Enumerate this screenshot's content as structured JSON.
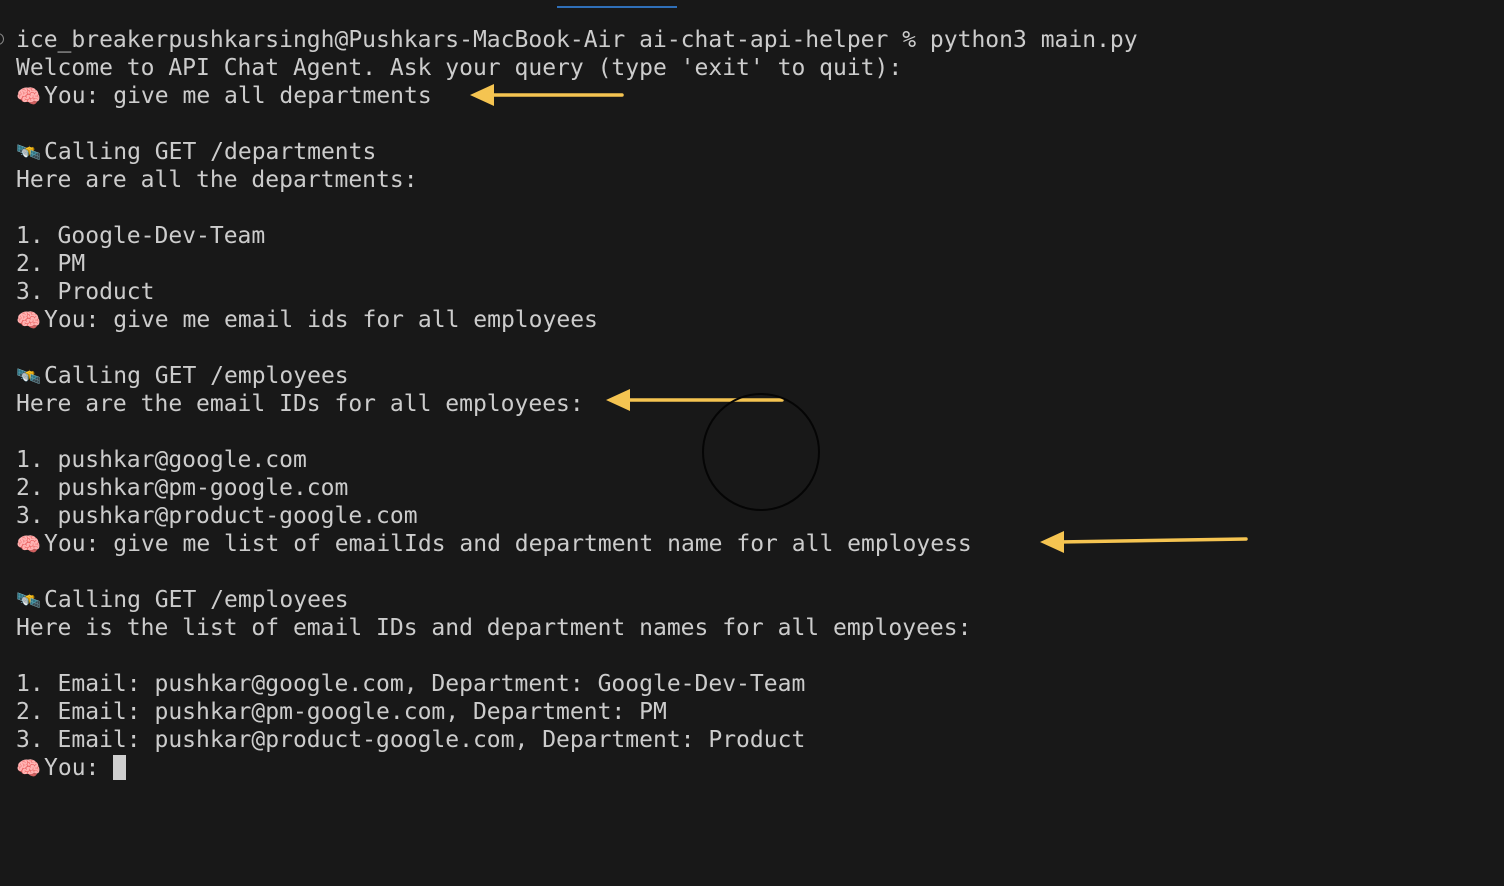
{
  "terminal": {
    "prompt_line": "ice_breakerpushkarsingh@Pushkars-MacBook-Air ai-chat-api-helper % python3 main.py",
    "welcome": "Welcome to API Chat Agent. Ask your query (type 'exit' to quit):",
    "user_emoji": "🧠",
    "tool_emoji": "🛰️",
    "q1": "You: give me all departments",
    "call1": "Calling GET /departments",
    "resp1_header": "Here are all the departments:",
    "resp1_items": [
      "1. Google-Dev-Team",
      "2. PM",
      "3. Product"
    ],
    "q2": "You: give me email ids for all employees",
    "call2": "Calling GET /employees",
    "resp2_header": "Here are the email IDs for all employees:",
    "resp2_items": [
      "1. pushkar@google.com",
      "2. pushkar@pm-google.com",
      "3. pushkar@product-google.com"
    ],
    "q3": "You: give me list of emailIds and department name for all employess",
    "call3": "Calling GET /employees",
    "resp3_header": "Here is the list of email IDs and department names for all employees:",
    "resp3_items": [
      "1. Email: pushkar@google.com, Department: Google-Dev-Team",
      "2. Email: pushkar@pm-google.com, Department: PM",
      "3. Email: pushkar@product-google.com, Department: Product"
    ],
    "current_prompt": "You: "
  },
  "colors": {
    "background": "#181818",
    "text": "#cccccc",
    "arrow": "#f5c451"
  }
}
